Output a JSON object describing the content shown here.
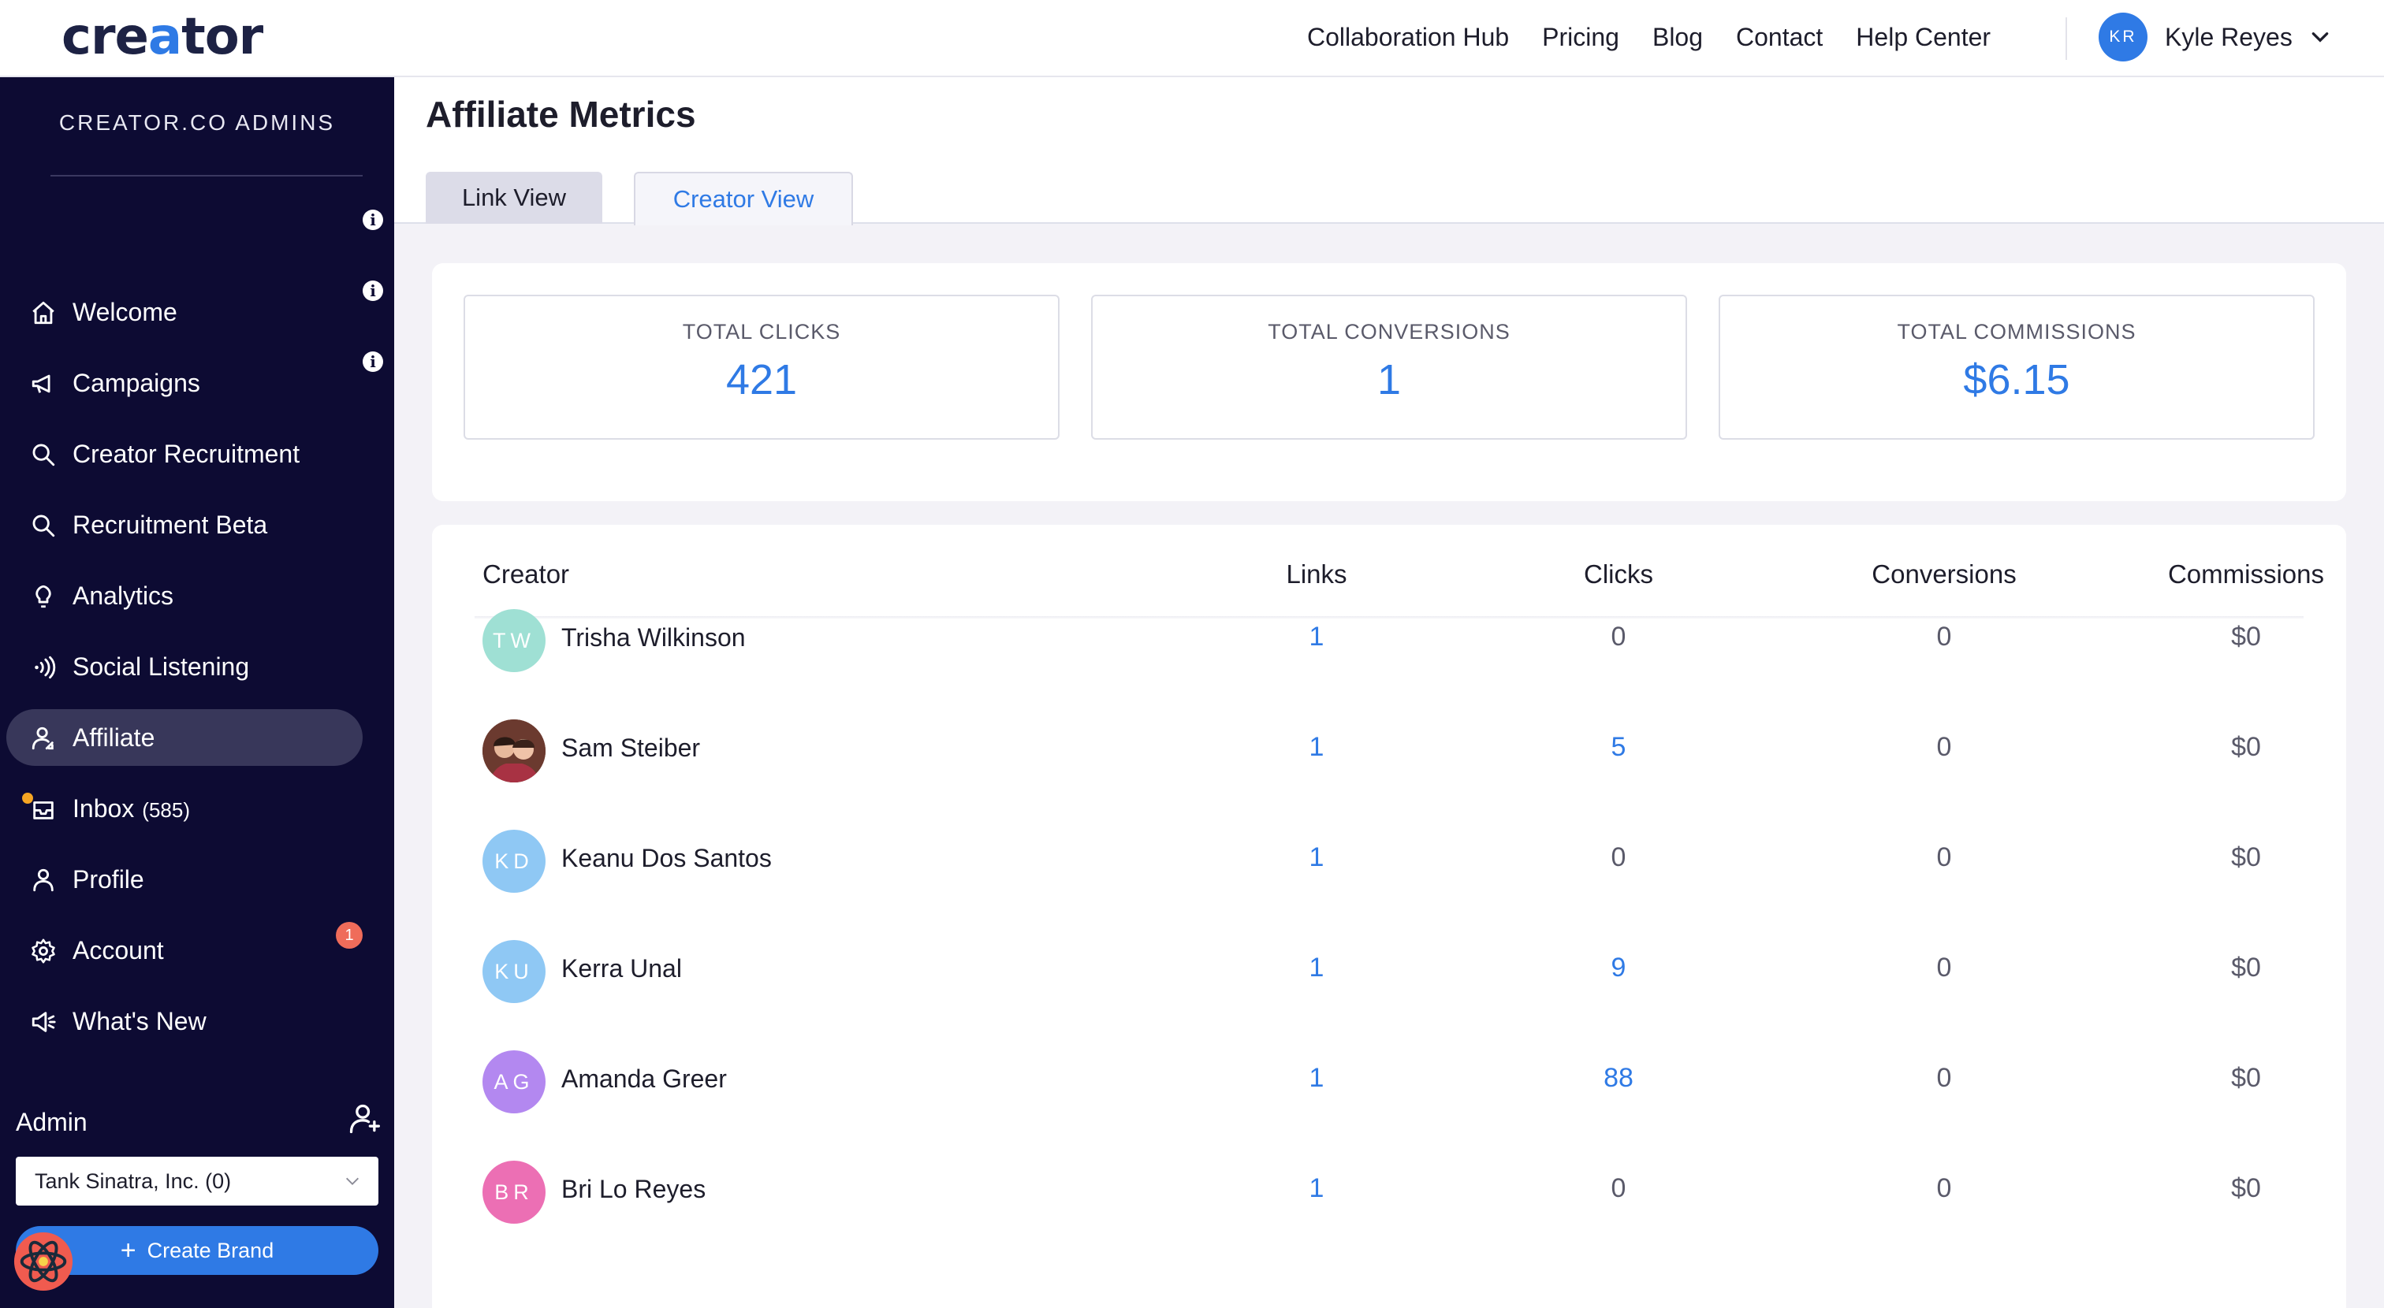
{
  "header": {
    "logo_pre": "cre",
    "logo_accent": "a",
    "logo_post": "tor",
    "nav": [
      "Collaboration Hub",
      "Pricing",
      "Blog",
      "Contact",
      "Help Center"
    ],
    "user": {
      "initials": "KR",
      "name": "Kyle Reyes"
    }
  },
  "sidebar": {
    "org_title": "CREATOR.CO ADMINS",
    "items": [
      {
        "label": "Welcome",
        "icon": "home-icon",
        "info": "i"
      },
      {
        "label": "Campaigns",
        "icon": "megaphone-icon",
        "info": "i"
      },
      {
        "label": "Creator Recruitment",
        "icon": "search-icon",
        "info": "i"
      },
      {
        "label": "Recruitment Beta",
        "icon": "search-icon"
      },
      {
        "label": "Analytics",
        "icon": "lightbulb-icon"
      },
      {
        "label": "Social Listening",
        "icon": "broadcast-icon"
      },
      {
        "label": "Affiliate",
        "icon": "users-icon",
        "active": true
      },
      {
        "label": "Inbox",
        "count": "(585)",
        "icon": "inbox-icon"
      },
      {
        "label": "Profile",
        "icon": "person-icon"
      },
      {
        "label": "Account",
        "icon": "gear-icon"
      },
      {
        "label": "What's New",
        "icon": "speaker-icon",
        "badge": "1"
      }
    ],
    "admin_label": "Admin",
    "brand_select": "Tank Sinatra, Inc. (0)",
    "create_brand": "Create Brand",
    "create_plus": "+"
  },
  "main": {
    "title": "Affiliate Metrics",
    "tabs": {
      "link_view": "Link View",
      "creator_view": "Creator View"
    },
    "stats": [
      {
        "label": "TOTAL CLICKS",
        "value": "421"
      },
      {
        "label": "TOTAL CONVERSIONS",
        "value": "1"
      },
      {
        "label": "TOTAL COMMISSIONS",
        "value": "$6.15"
      }
    ],
    "table": {
      "headers": [
        "Creator",
        "Links",
        "Clicks",
        "Conversions",
        "Commissions"
      ],
      "rows": [
        {
          "initials": "TW",
          "name": "Trisha Wilkinson",
          "avatar_color": "#9fe0d4",
          "links": "1",
          "clicks": "0",
          "conversions": "0",
          "commissions": "$0"
        },
        {
          "initials": "",
          "name": "Sam Steiber",
          "avatar_color": "#7a3b2e",
          "photo": true,
          "links": "1",
          "clicks": "5",
          "conversions": "0",
          "commissions": "$0"
        },
        {
          "initials": "KD",
          "name": "Keanu Dos Santos",
          "avatar_color": "#8fc8f4",
          "links": "1",
          "clicks": "0",
          "conversions": "0",
          "commissions": "$0"
        },
        {
          "initials": "KU",
          "name": "Kerra Unal",
          "avatar_color": "#8fc8f4",
          "links": "1",
          "clicks": "9",
          "conversions": "0",
          "commissions": "$0"
        },
        {
          "initials": "AG",
          "name": "Amanda Greer",
          "avatar_color": "#b388f0",
          "links": "1",
          "clicks": "88",
          "conversions": "0",
          "commissions": "$0"
        },
        {
          "initials": "BR",
          "name": "Bri Lo Reyes",
          "avatar_color": "#ec6fb4",
          "links": "1",
          "clicks": "0",
          "conversions": "0",
          "commissions": "$0"
        }
      ]
    }
  },
  "colors": {
    "accent": "#2f7ae5",
    "sidebar_bg": "#0d0b33",
    "badge": "#ef6c5a",
    "notif": "#f6a623"
  }
}
